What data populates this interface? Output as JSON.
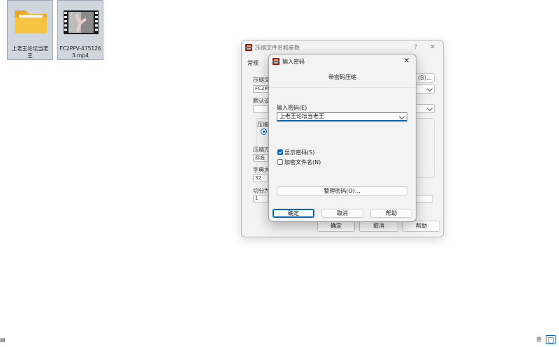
{
  "desktop": {
    "files": [
      {
        "name_line1": "上老王论坛当老",
        "name_line2": "王",
        "icon": "folder-icon"
      },
      {
        "name_line1": "FC2PPV-475126",
        "name_line2": "3.mp4",
        "icon": "video-thumbnail"
      }
    ]
  },
  "back_dialog": {
    "title": "压缩文件名和参数",
    "help_glyph": "?",
    "close_glyph": "✕",
    "tab_general": "常规",
    "archive_label": "压缩文",
    "archive_value": "FC2PP",
    "browse_label": "(B)...",
    "profile_label": "默认设",
    "format_group_label": "压缩",
    "method_label": "压缩方",
    "method_value": "标准",
    "dict_label": "字典大",
    "dict_value": "32",
    "split_label": "切分为",
    "split_value": "1",
    "ok": "确定",
    "cancel": "取消",
    "help": "帮助"
  },
  "password_dialog": {
    "title": "输入密码",
    "close_glyph": "✕",
    "heading": "带密码压缩",
    "password_label": "输入密码(E)",
    "password_value": "上老王论坛当老王",
    "show_password": {
      "label": "显示密码(S)",
      "checked": true
    },
    "encrypt_names": {
      "label": "加密文件名(N)",
      "checked": false
    },
    "organize_button": "整理密码(O)...",
    "ok": "确定",
    "cancel": "取消",
    "help": "帮助"
  },
  "corners": {
    "left_glyph": "▤",
    "right_glyph_list": "≣",
    "right_glyph_box": "▢"
  },
  "colors": {
    "accent": "#0067c0",
    "winrar_red": "#8e1b1b"
  }
}
